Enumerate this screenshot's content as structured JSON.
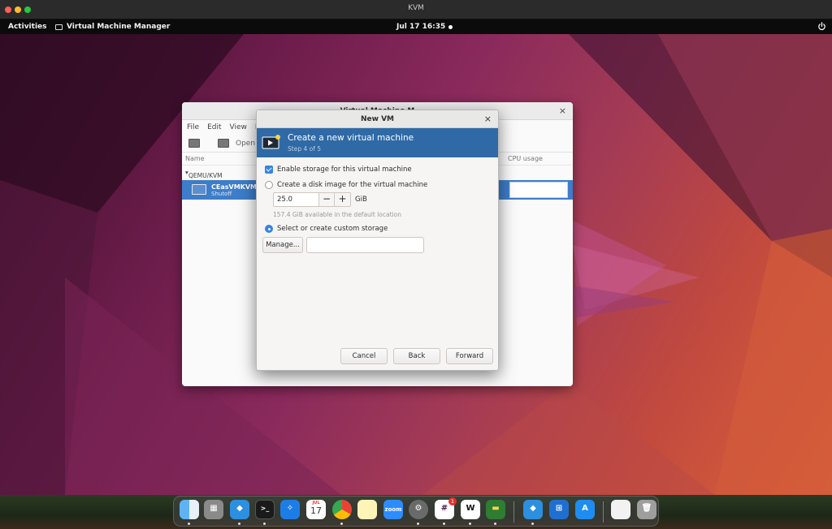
{
  "host_window": {
    "title": "KVM"
  },
  "top_bar": {
    "activities": "Activities",
    "app_name": "Virtual Machine Manager",
    "clock": "Jul 17  16:35"
  },
  "vmm": {
    "title": "Virtual Machine M",
    "menu": [
      "File",
      "Edit",
      "View",
      "H"
    ],
    "toolbar_open": "Open",
    "columns": {
      "name": "Name",
      "cpu": "CPU usage"
    },
    "group": "QEMU/KVM",
    "vm": {
      "name": "CEasVMKVM",
      "status": "Shutoff"
    }
  },
  "dialog": {
    "title": "New VM",
    "close": "×",
    "header_title": "Create a new virtual machine",
    "header_step": "Step 4 of 5",
    "enable_storage_label": "Enable storage for this virtual machine",
    "enable_storage_checked": true,
    "create_disk_label": "Create a disk image for the virtual machine",
    "disk_size": "25.0",
    "disk_unit": "GiB",
    "available_note": "157.4 GiB available in the default location",
    "custom_storage_label": "Select or create custom storage",
    "selected_option": "custom",
    "manage_button": "Manage...",
    "storage_path": "",
    "cancel_button": "Cancel",
    "back_button": "Back",
    "forward_button": "Forward"
  },
  "dock": {
    "calendar_month": "JUL",
    "calendar_day": "17",
    "zoom_label": "zoom",
    "slack_badge": "1"
  },
  "colors": {
    "accent": "#3584e4",
    "header_blue": "#2f6aa6",
    "selection": "#3d7dc9"
  }
}
